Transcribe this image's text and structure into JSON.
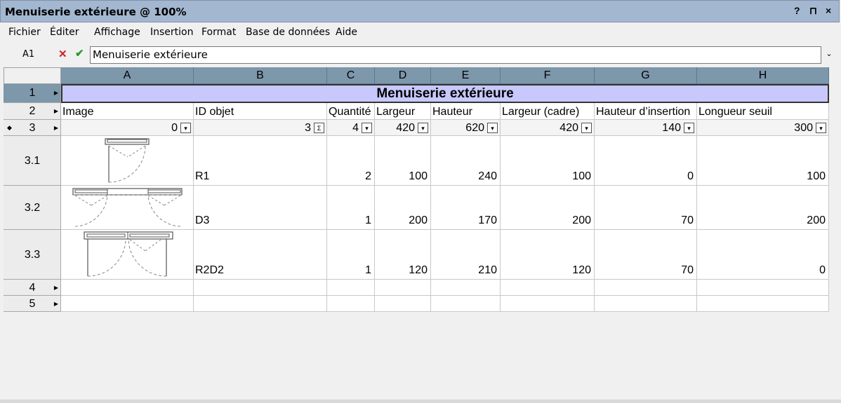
{
  "window": {
    "title": "Menuiserie extérieure @ 100%",
    "buttons": [
      "?",
      "⊓",
      "×"
    ]
  },
  "menu": [
    "Fichier",
    "Éditer",
    "Affichage",
    "Insertion",
    "Format",
    "Base de données",
    "Aide"
  ],
  "formula_bar": {
    "cell_ref": "A1",
    "cancel": "✕",
    "accept": "✔",
    "value": "Menuiserie extérieure",
    "dropdown": "⌄"
  },
  "columns": [
    "A",
    "B",
    "C",
    "D",
    "E",
    "F",
    "G",
    "H"
  ],
  "rows": [
    "1",
    "2",
    "3",
    "3.1",
    "3.2",
    "3.3",
    "4",
    "5"
  ],
  "title_row": "Menuiserie extérieure",
  "headers": [
    "Image",
    "ID objet",
    "Quantité",
    "Largeur",
    "Hauteur",
    "Largeur (cadre)",
    "Hauteur d’insertion",
    "Longueur seuil"
  ],
  "summary": [
    "0",
    "3",
    "4",
    "420",
    "620",
    "420",
    "140",
    "300"
  ],
  "summary_icons": [
    "▾",
    "Σ",
    "▾",
    "▾",
    "▾",
    "▾",
    "▾",
    "▾"
  ],
  "data_rows": [
    {
      "id": "R1",
      "qty": "2",
      "w": "100",
      "h": "240",
      "wf": "100",
      "hi": "0",
      "ls": "100",
      "image": "single-door-icon"
    },
    {
      "id": "D3",
      "qty": "1",
      "w": "200",
      "h": "170",
      "wf": "200",
      "hi": "70",
      "ls": "200",
      "image": "double-window-icon"
    },
    {
      "id": "R2D2",
      "qty": "1",
      "w": "120",
      "h": "210",
      "wf": "120",
      "hi": "70",
      "ls": "0",
      "image": "double-door-icon"
    }
  ]
}
